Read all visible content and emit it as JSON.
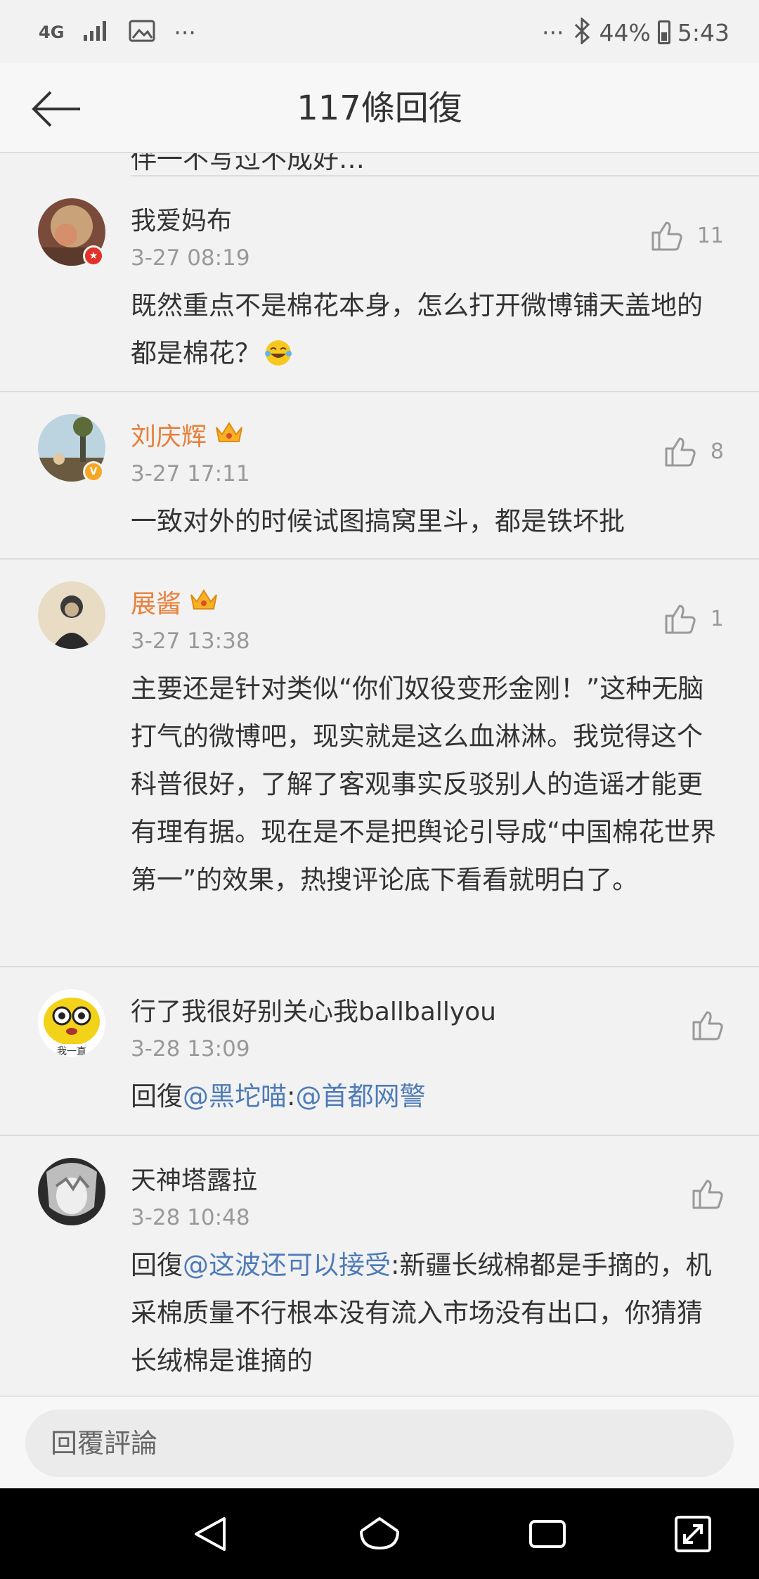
{
  "status_bar": {
    "network": "4G",
    "more_left": "···",
    "more_right": "···",
    "battery": "44%",
    "time": "5:43"
  },
  "header": {
    "title": "117條回復",
    "back_icon": "arrow-left-icon"
  },
  "peek_text": "伴一不写过不成好…",
  "comments": [
    {
      "username": "我爱妈布",
      "vip": false,
      "time": "3-27 08:19",
      "likes": "11",
      "text": "既然重点不是棉花本身，怎么打开微博铺天盖地的都是棉花？",
      "emoji": "laugh-cry-emoji",
      "badge": "red",
      "avatar_colors": [
        "#7a4b3a",
        "#c9a27a",
        "#d58f6a"
      ]
    },
    {
      "username": "刘庆辉",
      "vip": true,
      "time": "3-27 17:11",
      "likes": "8",
      "text": "一致对外的时候试图搞窝里斗，都是铁坏批",
      "badge": "gold",
      "avatar_colors": [
        "#bcd3e0",
        "#6a5a3f",
        "#e3c7a1"
      ]
    },
    {
      "username": "展酱",
      "vip": true,
      "time": "3-27 13:38",
      "likes": "1",
      "text": "主要还是针对类似“你们奴役变形金刚！”这种无脑打气的微博吧，现实就是这么血淋淋。我觉得这个科普很好，了解了客观事实反驳别人的造谣才能更有理有据。现在是不是把舆论引导成“中国棉花世界第一”的效果，热搜评论底下看看就明白了。",
      "avatar_colors": [
        "#e8dcc4",
        "#3a3a3a",
        "#c9b08e"
      ]
    },
    {
      "username": "行了我很好别关心我ballballyou",
      "vip": false,
      "time": "3-28 13:09",
      "likes": "",
      "reply_prefix": "回復",
      "mention": "@黑坨喵",
      "sep": ":",
      "mention2": "@首都网警",
      "rest": "",
      "avatar_caption": "我一直",
      "avatar_colors": [
        "#f3d21a",
        "#ffffff",
        "#222222"
      ]
    },
    {
      "username": "天神塔露拉",
      "vip": false,
      "time": "3-28 10:48",
      "likes": "",
      "reply_prefix": "回復",
      "mention": "@这波还可以接受",
      "sep": ":",
      "mention2": "",
      "rest": "新疆长绒棉都是手摘的，机采棉质量不行根本没有流入市场没有出口，你猜猜长绒棉是谁摘的",
      "avatar_colors": [
        "#2b2b2b",
        "#bdbdbd",
        "#eeeeee"
      ]
    }
  ],
  "reply_bar": {
    "placeholder": "回覆評論"
  },
  "system_nav": [
    "back-triangle-icon",
    "home-icon",
    "recents-icon",
    "expand-icon"
  ]
}
